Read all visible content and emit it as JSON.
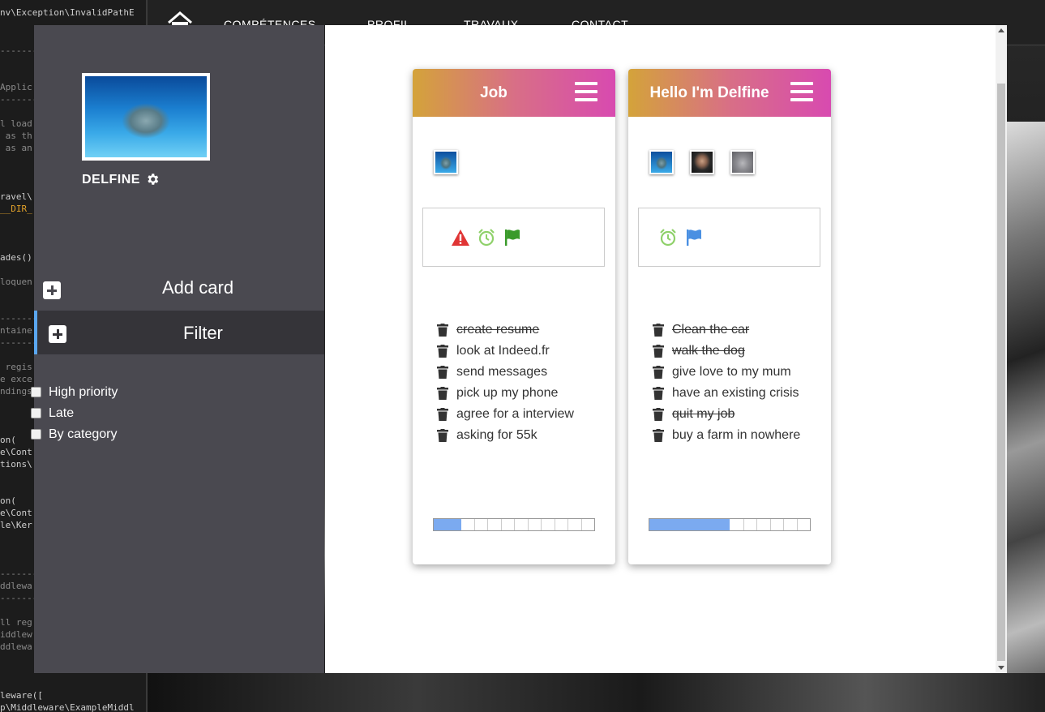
{
  "background": {
    "code_lines": [
      {
        "text": "nv\\Exception\\InvalidPathE",
        "cls": ""
      },
      {
        "text": "-------",
        "cls": "c"
      },
      {
        "text": "Applic",
        "cls": "c"
      },
      {
        "text": "-------",
        "cls": "c"
      },
      {
        "text": "l load",
        "cls": "c"
      },
      {
        "text": " as th",
        "cls": "c"
      },
      {
        "text": " as an",
        "cls": "c"
      },
      {
        "text": "ravel\\",
        "cls": ""
      },
      {
        "text": "__DIR_",
        "cls": "o"
      },
      {
        "text": "ades()",
        "cls": ""
      },
      {
        "text": "loquen",
        "cls": "c"
      },
      {
        "text": "-------",
        "cls": "c"
      },
      {
        "text": "ntaine",
        "cls": "c"
      },
      {
        "text": "-------",
        "cls": "c"
      },
      {
        "text": " regis",
        "cls": "c"
      },
      {
        "text": "e exce",
        "cls": "c"
      },
      {
        "text": "ndings",
        "cls": "c"
      },
      {
        "text": "on(",
        "cls": ""
      },
      {
        "text": "e\\Cont",
        "cls": ""
      },
      {
        "text": "tions\\",
        "cls": ""
      },
      {
        "text": "on(",
        "cls": ""
      },
      {
        "text": "e\\Cont",
        "cls": ""
      },
      {
        "text": "le\\Ker",
        "cls": ""
      },
      {
        "text": "-------",
        "cls": "c"
      },
      {
        "text": "ddlewa",
        "cls": "c"
      },
      {
        "text": "-------",
        "cls": "c"
      },
      {
        "text": "ll reg",
        "cls": "c"
      },
      {
        "text": "iddlew",
        "cls": "c"
      },
      {
        "text": "ddlewa",
        "cls": "c"
      },
      {
        "text": "leware([",
        "cls": ""
      },
      {
        "text": "p\\Middleware\\ExampleMiddl",
        "cls": ""
      }
    ]
  },
  "topnav": {
    "items": [
      "COMPÉTENCES",
      "PROFIL",
      "TRAVAUX",
      "CONTACT"
    ]
  },
  "sidebar": {
    "user_name": "DELFINE",
    "add_card_label": "Add card",
    "filter_label": "Filter",
    "filter_options": [
      {
        "label": "High priority",
        "checked": false
      },
      {
        "label": "Late",
        "checked": false
      },
      {
        "label": "By category",
        "checked": false
      }
    ]
  },
  "cards": [
    {
      "title": "Job",
      "members": [
        "dolphin"
      ],
      "labels": [
        {
          "icon": "warning-icon",
          "color": "#e03535"
        },
        {
          "icon": "alarm-clock-icon",
          "color": "#8fd16a"
        },
        {
          "icon": "flag-icon",
          "color": "#3a9a2a"
        }
      ],
      "tasks": [
        {
          "text": "create resume",
          "done": true
        },
        {
          "text": "look at Indeed.fr",
          "done": false
        },
        {
          "text": "send messages",
          "done": false
        },
        {
          "text": "pick up my phone",
          "done": false
        },
        {
          "text": "agree for a interview",
          "done": false
        },
        {
          "text": "asking for 55k",
          "done": false
        }
      ],
      "progress": 0.17
    },
    {
      "title": "Hello I'm Delfine",
      "members": [
        "dolphin",
        "man",
        "cat"
      ],
      "labels": [
        {
          "icon": "alarm-clock-icon",
          "color": "#8fd16a"
        },
        {
          "icon": "flag-icon",
          "color": "#4a90e2"
        }
      ],
      "tasks": [
        {
          "text": "Clean the car",
          "done": true
        },
        {
          "text": "walk the dog",
          "done": true
        },
        {
          "text": "give love to my mum",
          "done": false
        },
        {
          "text": "have an existing crisis",
          "done": false
        },
        {
          "text": "quit my job",
          "done": true
        },
        {
          "text": "buy a farm in nowhere",
          "done": false
        }
      ],
      "progress": 0.5
    }
  ],
  "colors": {
    "sidebar_bg": "#4a4950",
    "accent": "#5aa7f0",
    "progress_fill": "#7baaf0",
    "header_gradient": [
      "#d4a33a",
      "#d86f86",
      "#d84ab0"
    ]
  }
}
